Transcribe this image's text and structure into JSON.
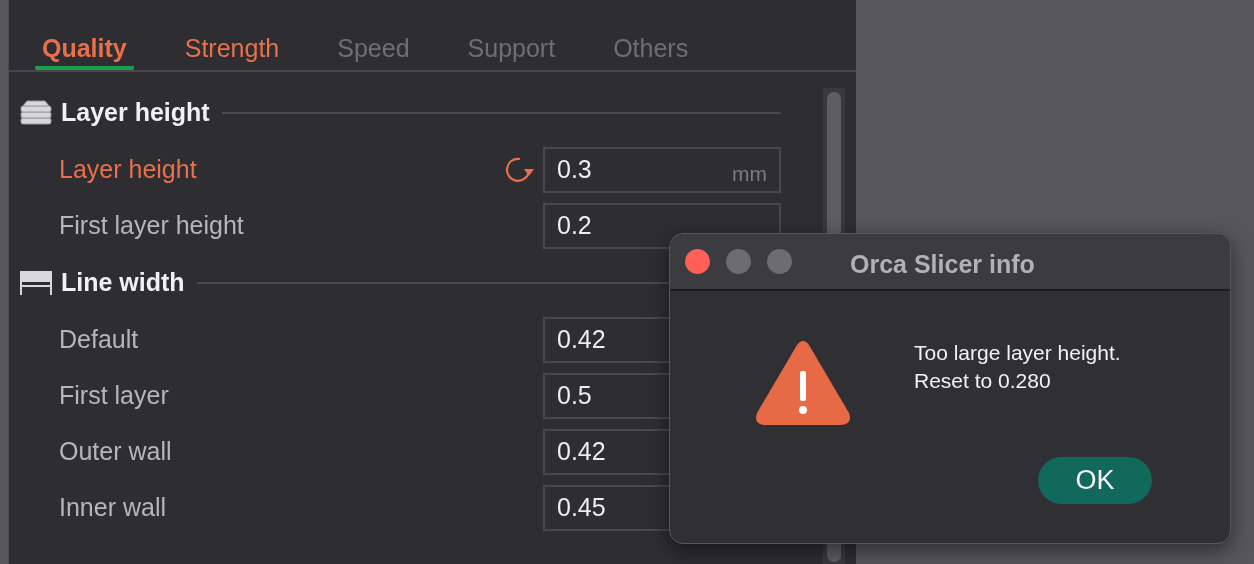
{
  "tabs": [
    {
      "label": "Quality",
      "selected": true,
      "modified": false
    },
    {
      "label": "Strength",
      "selected": false,
      "modified": true
    },
    {
      "label": "Speed",
      "selected": false,
      "modified": false
    },
    {
      "label": "Support",
      "selected": false,
      "modified": false
    },
    {
      "label": "Others",
      "selected": false,
      "modified": false
    }
  ],
  "sections": [
    {
      "title": "Layer height",
      "kind": "layers",
      "settings": [
        {
          "label": "Layer height",
          "modified": true,
          "value": "0.3",
          "unit": "mm"
        },
        {
          "label": "First layer height",
          "modified": false,
          "value": "0.2"
        }
      ]
    },
    {
      "title": "Line width",
      "kind": "width",
      "settings": [
        {
          "label": "Default",
          "modified": false,
          "value": "0.42"
        },
        {
          "label": "First layer",
          "modified": false,
          "value": "0.5"
        },
        {
          "label": "Outer wall",
          "modified": false,
          "value": "0.42"
        },
        {
          "label": "Inner wall",
          "modified": false,
          "value": "0.45"
        }
      ]
    }
  ],
  "dialog": {
    "title": "Orca Slicer info",
    "message": [
      "Too large layer height.",
      "Reset to 0.280"
    ],
    "buttons": [
      "OK"
    ]
  }
}
